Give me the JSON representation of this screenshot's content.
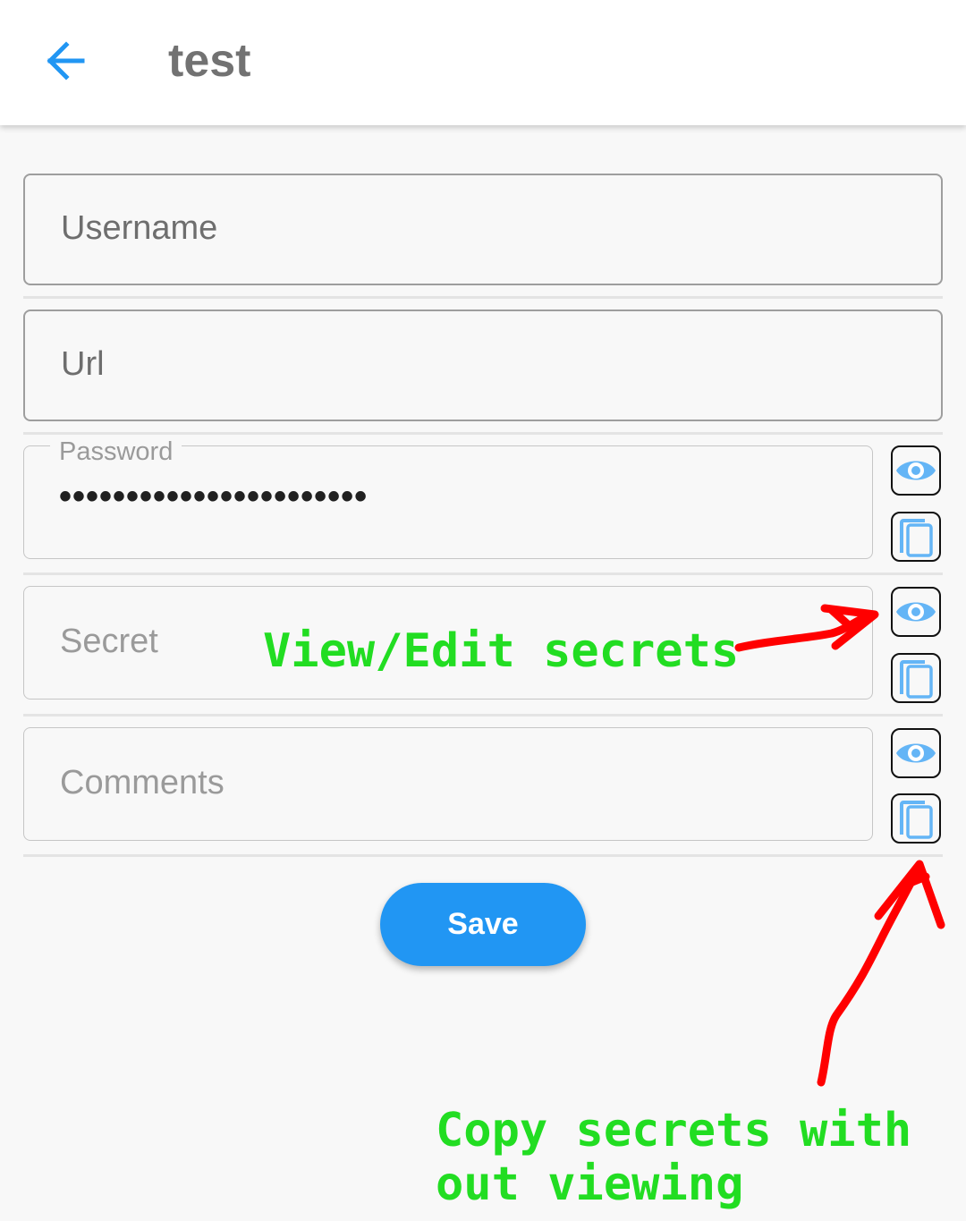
{
  "appbar": {
    "title": "test",
    "back_icon": "arrow-back-icon"
  },
  "form": {
    "username_label": "Username",
    "url_label": "Url",
    "password_label": "Password",
    "password_value": "•••••••••••••••••••••••",
    "secret_label": "Secret",
    "comments_label": "Comments",
    "save_label": "Save"
  },
  "icons": {
    "view": "eye-icon",
    "copy": "copy-icon"
  },
  "annotations": {
    "view_edit": "View/Edit secrets",
    "copy_line1": "Copy secrets with",
    "copy_line2": "out viewing"
  },
  "colors": {
    "accent": "#2196f3",
    "annotation_text": "#22dd22",
    "annotation_arrow": "#ff0000"
  }
}
